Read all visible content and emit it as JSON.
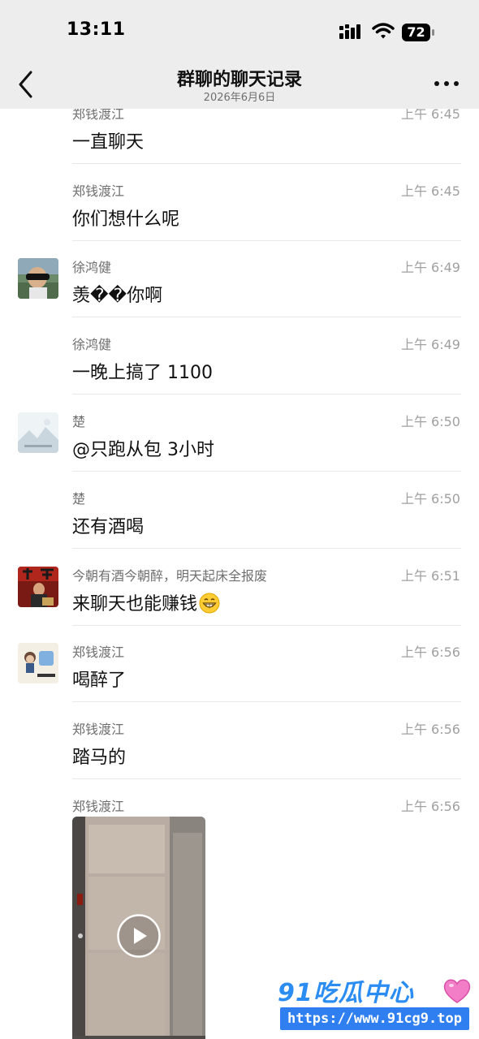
{
  "status_bar": {
    "time": "13:11",
    "battery": "72"
  },
  "nav": {
    "title": "群聊的聊天记录",
    "subtitle": "2026年6月6日"
  },
  "messages": [
    {
      "sender": "郑钱渡江",
      "time": "上午 6:45",
      "text": "一直聊天"
    },
    {
      "sender": "郑钱渡江",
      "time": "上午 6:45",
      "text": "你们想什么呢"
    },
    {
      "sender": "徐鸿健",
      "time": "上午 6:49",
      "text": "羡��你啊"
    },
    {
      "sender": "徐鸿健",
      "time": "上午 6:49",
      "text": "一晚上搞了 1100"
    },
    {
      "sender": "楚",
      "time": "上午 6:50",
      "text": "@只跑从包 3小时"
    },
    {
      "sender": "楚",
      "time": "上午 6:50",
      "text": "还有酒喝"
    },
    {
      "sender": "今朝有酒今朝醉，明天起床全报废",
      "time": "上午 6:51",
      "text": "来聊天也能赚钱",
      "emoji": "grinning-face"
    },
    {
      "sender": "郑钱渡江",
      "time": "上午 6:56",
      "text": "喝醉了"
    },
    {
      "sender": "郑钱渡江",
      "time": "上午 6:56",
      "text": "踏马的"
    },
    {
      "sender": "郑钱渡江",
      "time": "上午 6:56",
      "attachment": "video"
    }
  ],
  "watermark": {
    "logo": "91吃瓜中心",
    "url": "https://www.91cg9.top"
  },
  "icons": {
    "back": "chevron-left-icon",
    "more": "more-dots-icon",
    "play": "play-icon"
  },
  "colors": {
    "header_bg": "#ededed",
    "sender": "#6f6f6f",
    "time": "#a0a0a0",
    "watermark_blue": "#2f7ff0"
  }
}
